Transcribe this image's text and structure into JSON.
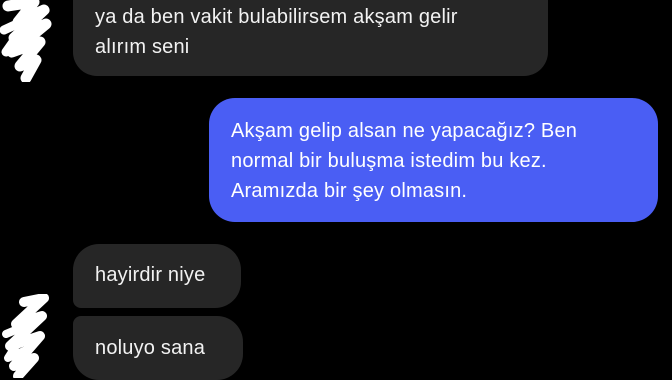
{
  "conversation": {
    "messages": [
      {
        "sender": "other",
        "lines": [
          "ya da ben vakit bulabilirsem akşam gelir",
          "alırım seni"
        ]
      },
      {
        "sender": "me",
        "lines": [
          "Akşam gelip alsan ne yapacağız? Ben",
          "normal bir buluşma istedim bu kez.",
          "Aramızda bir şey olmasın."
        ]
      },
      {
        "sender": "other",
        "lines": [
          "hayirdir niye"
        ]
      },
      {
        "sender": "other",
        "lines": [
          "noluyo sana"
        ]
      }
    ]
  },
  "colors": {
    "background": "#000000",
    "incoming_bubble": "#262626",
    "outgoing_bubble": "#4a5ef4",
    "text": "#f2f2f2",
    "redaction": "#ffffff"
  }
}
